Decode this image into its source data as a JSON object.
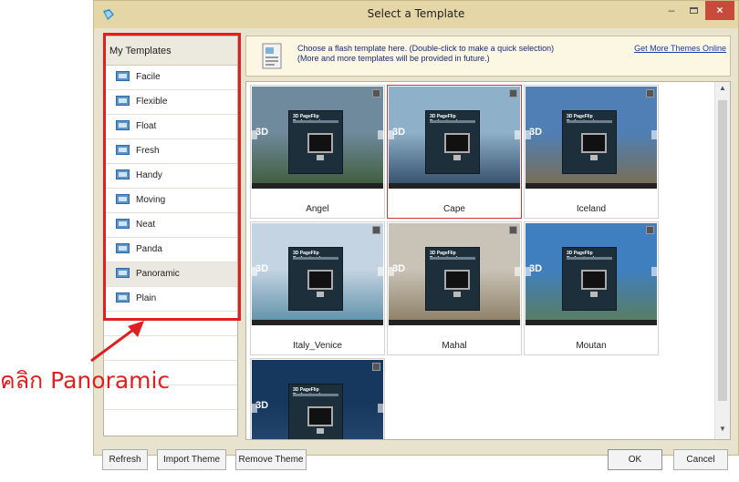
{
  "window": {
    "title": "Select a Template",
    "close_glyph": "×",
    "minimize_glyph": "–"
  },
  "sidebar": {
    "header": "My Templates",
    "items": [
      {
        "label": "Facile"
      },
      {
        "label": "Flexible"
      },
      {
        "label": "Float"
      },
      {
        "label": "Fresh"
      },
      {
        "label": "Handy"
      },
      {
        "label": "Moving"
      },
      {
        "label": "Neat"
      },
      {
        "label": "Panda"
      },
      {
        "label": "Panoramic",
        "selected": true
      },
      {
        "label": "Plain"
      }
    ]
  },
  "info": {
    "line1": "Choose a flash template here. (Double-click to make a quick selection)",
    "line2": "(More and more templates will be provided in future.)",
    "link": "Get More Themes Online"
  },
  "gallery": {
    "book_title": "3D PageFlip Professional",
    "mark": "3D",
    "items": [
      {
        "label": "Angel",
        "sky": "#6f8a9c",
        "ground": "#3d5a36"
      },
      {
        "label": "Cape",
        "sky": "#8fb0c9",
        "ground": "#2f4a66",
        "selected": true
      },
      {
        "label": "Iceland",
        "sky": "#4f7fb5",
        "ground": "#7c6d4e"
      },
      {
        "label": "Italy_Venice",
        "sky": "#c4d4e2",
        "ground": "#5b8ea6"
      },
      {
        "label": "Mahal",
        "sky": "#c9c3b7",
        "ground": "#8a7c62"
      },
      {
        "label": "Moutan",
        "sky": "#3f7fbf",
        "ground": "#5c7d5a"
      },
      {
        "label": "",
        "sky": "#17385e",
        "ground": "#2b4f78"
      }
    ]
  },
  "buttons": {
    "refresh": "Refresh",
    "import": "Import Theme",
    "remove": "Remove Theme",
    "ok": "OK",
    "cancel": "Cancel"
  },
  "annotation": {
    "text": "คลิก Panoramic",
    "color": "#e02020"
  },
  "colors": {
    "titlebar": "#e4d6a6",
    "selection": "#d43333"
  }
}
